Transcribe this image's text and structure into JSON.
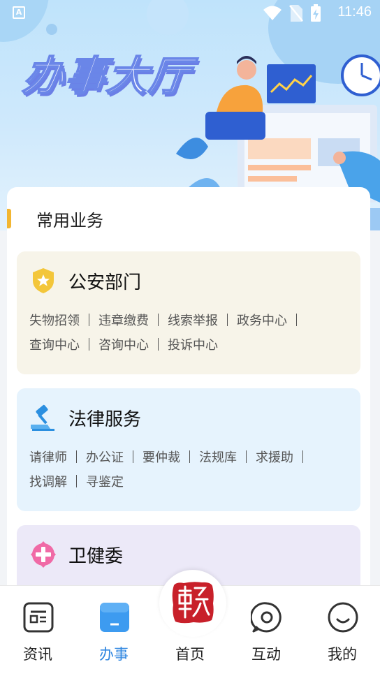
{
  "status_bar": {
    "time": "11:46",
    "left_icon": "A"
  },
  "banner": {
    "title": "办事大厅"
  },
  "section": {
    "title": "常用业务"
  },
  "cards": [
    {
      "title": "公安部门",
      "icon": "police-badge-icon",
      "background": "#f7f4e9",
      "links": [
        "失物招领",
        "违章缴费",
        "线索举报",
        "政务中心",
        "查询中心",
        "咨询中心",
        "投诉中心"
      ]
    },
    {
      "title": "法律服务",
      "icon": "gavel-icon",
      "background": "#e6f3fd",
      "links": [
        "请律师",
        "办公证",
        "要仲裁",
        "法规库",
        "求援助",
        "找调解",
        "寻鉴定"
      ]
    },
    {
      "title": "卫健委",
      "icon": "medical-cross-icon",
      "background": "#ece9f8",
      "links": []
    }
  ],
  "bottom_nav": {
    "active_color": "#2f86e0",
    "items": [
      {
        "label": "资讯",
        "icon": "news-icon"
      },
      {
        "label": "办事",
        "icon": "services-icon"
      },
      {
        "label": "首页",
        "icon": "home-seal-icon"
      },
      {
        "label": "互动",
        "icon": "interaction-icon"
      },
      {
        "label": "我的",
        "icon": "profile-icon"
      }
    ]
  }
}
